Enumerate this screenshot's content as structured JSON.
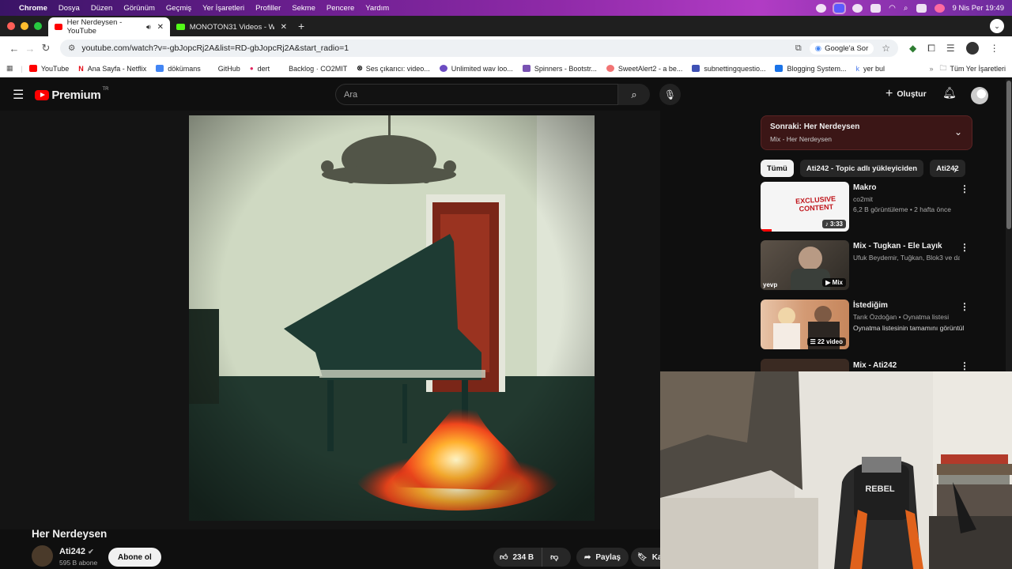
{
  "menubar": {
    "app": "Chrome",
    "items": [
      "Dosya",
      "Düzen",
      "Görünüm",
      "Geçmiş",
      "Yer İşaretleri",
      "Profiller",
      "Sekme",
      "Pencere",
      "Yardım"
    ],
    "datetime": "9 Nis Per  19:49"
  },
  "tabs": [
    {
      "title": "Her Nerdeysen - YouTube",
      "active": true,
      "favicon_color": "#ff0000"
    },
    {
      "title": "MONOTON31 Videos - Watch",
      "active": false,
      "favicon_color": "#53fc18"
    }
  ],
  "address": {
    "url": "youtube.com/watch?v=-gbJopcRj2A&list=RD-gbJopcRj2A&start_radio=1",
    "ask_google": "Google'a Sor"
  },
  "bookmarks": {
    "items": [
      {
        "label": "YouTube",
        "color": "#ff0000"
      },
      {
        "label": "Ana Sayfa - Netflix",
        "color": "#e50914"
      },
      {
        "label": "dökümans",
        "color": "#4285f4"
      },
      {
        "label": "GitHub",
        "color": "#ffffff"
      },
      {
        "label": "dert",
        "color": "#e0245e"
      },
      {
        "label": "Backlog · CO2MIT",
        "color": "#ffffff"
      },
      {
        "label": "Ses çıkarıcı: video...",
        "color": "#222222"
      },
      {
        "label": "Unlimited wav loo...",
        "color": "#6c4cc2"
      },
      {
        "label": "Spinners - Bootstr...",
        "color": "#7952b3"
      },
      {
        "label": "SweetAlert2 - a be...",
        "color": "#f27474"
      },
      {
        "label": "subnettingquestio...",
        "color": "#3f51b5"
      },
      {
        "label": "Blogging System...",
        "color": "#1a73e8"
      },
      {
        "label": "yer bul",
        "color": "#4b7bec"
      }
    ],
    "all_bookmarks": "Tüm Yer İşaretleri"
  },
  "youtube": {
    "logo": "Premium",
    "region": "TR",
    "search_placeholder": "Ara",
    "create_label": "Oluştur"
  },
  "video": {
    "title": "Her Nerdeysen",
    "channel": "Ati242",
    "subscribers": "595 B abone",
    "subscribe_label": "Abone ol",
    "likes": "234 B",
    "share_label": "Paylaş",
    "save_label": "Kaydet"
  },
  "up_next": {
    "title": "Sonraki: Her Nerdeysen",
    "subtitle": "Mix - Her Nerdeysen"
  },
  "chips": [
    {
      "label": "Tümü",
      "selected": true
    },
    {
      "label": "Ati242 - Topic adlı yükleyiciden",
      "selected": false
    },
    {
      "label": "Ati242",
      "selected": false
    }
  ],
  "recommendations": [
    {
      "title": "Makro",
      "channel": "co2mit",
      "meta": "6,2 B görüntüleme • 2 hafta önce",
      "badge": "3:33"
    },
    {
      "title": "Mix - Tugkan - Ele Layık",
      "channel": "Ufuk Beydemir, Tuğkan, Blok3 ve daha fazlası",
      "meta": "",
      "badge": "Mix"
    },
    {
      "title": "İstediğim",
      "channel": "Tarık Özdoğan • Oynatma listesi",
      "meta": "Oynatma listesinin tamamını görüntüle",
      "badge": "22 video"
    },
    {
      "title": "Mix - Ati242",
      "channel": "",
      "meta": "",
      "badge": ""
    }
  ],
  "thumbnail_text": {
    "makro": "EXCLUSIVE CONTENT",
    "yevp": "yevp"
  },
  "webcam": {
    "chair_brand": "REBEL"
  },
  "colors": {
    "yt_red": "#ff0000",
    "bg": "#0f0f0f",
    "upnext_bg": "#3b1616"
  }
}
